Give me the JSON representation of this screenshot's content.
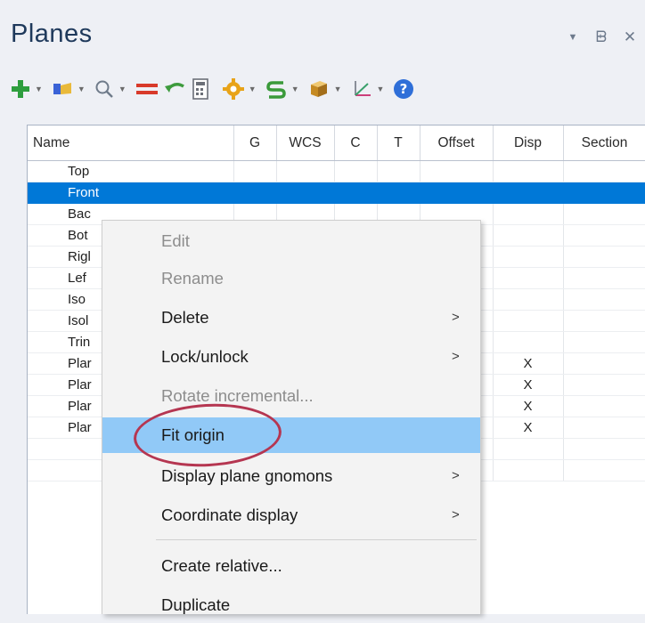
{
  "panel": {
    "title": "Planes",
    "controls": {
      "dropdown_icon": "▼",
      "pin_icon": "ᗸ",
      "close_icon": "✕"
    }
  },
  "toolbar": {
    "items": [
      {
        "icon": "add-icon",
        "has_dropdown": true,
        "color": "#2e9e3e"
      },
      {
        "icon": "planes-folder-icon",
        "has_dropdown": true,
        "color": "#3a62d6"
      },
      {
        "icon": "search-icon",
        "has_dropdown": true,
        "color": "#6f7b8a"
      },
      {
        "icon": "equal-icon",
        "has_dropdown": false,
        "color": "#d83a2a"
      },
      {
        "icon": "undo-arrow-icon",
        "has_dropdown": false,
        "color": "#3d9b3d"
      },
      {
        "icon": "calculator-icon",
        "has_dropdown": false,
        "color": "#6b6f78"
      },
      {
        "icon": "gear-icon",
        "has_dropdown": true,
        "color": "#e8a318"
      },
      {
        "icon": "rotate-s-icon",
        "has_dropdown": true,
        "color": "#3a9a3a"
      },
      {
        "icon": "box-icon",
        "has_dropdown": true,
        "color": "#d7a636"
      },
      {
        "icon": "axis-gnomon-icon",
        "has_dropdown": true,
        "color": "#cc3f7a"
      },
      {
        "icon": "help-icon",
        "has_dropdown": false,
        "color": "#2f6fd8"
      }
    ]
  },
  "grid": {
    "columns": [
      "Name",
      "G",
      "WCS",
      "C",
      "T",
      "Offset",
      "Disp",
      "Section"
    ],
    "rows": [
      {
        "name": "Top",
        "disp": ""
      },
      {
        "name": "Front",
        "disp": "",
        "selected": true
      },
      {
        "name": "Bac",
        "disp": ""
      },
      {
        "name": "Bot",
        "disp": ""
      },
      {
        "name": "Rigl",
        "disp": ""
      },
      {
        "name": "Lef",
        "disp": ""
      },
      {
        "name": "Iso",
        "disp": ""
      },
      {
        "name": "Isol",
        "disp": ""
      },
      {
        "name": "Trin",
        "disp": ""
      },
      {
        "name": "Plar",
        "disp": "X"
      },
      {
        "name": "Plar",
        "disp": "X"
      },
      {
        "name": "Plar",
        "disp": "X"
      },
      {
        "name": "Plar",
        "disp": "X"
      },
      {
        "name": "",
        "disp": ""
      },
      {
        "name": "",
        "disp": ""
      }
    ]
  },
  "context_menu": {
    "items": [
      {
        "label": "Edit",
        "enabled": false,
        "submenu": false
      },
      {
        "label": "Rename",
        "enabled": false,
        "submenu": false
      },
      {
        "label": "Delete",
        "enabled": true,
        "submenu": true
      },
      {
        "label": "Lock/unlock",
        "enabled": true,
        "submenu": true
      },
      {
        "label": "Rotate incremental...",
        "enabled": false,
        "submenu": false
      },
      {
        "label": "Fit origin",
        "enabled": true,
        "submenu": false,
        "hovered": true
      },
      {
        "label": "Display plane gnomons",
        "enabled": true,
        "submenu": true
      },
      {
        "label": "Coordinate display",
        "enabled": true,
        "submenu": true
      },
      {
        "label": "Create relative...",
        "enabled": true,
        "submenu": false
      },
      {
        "label": "Duplicate",
        "enabled": true,
        "submenu": false
      }
    ],
    "submenu_arrow": ">",
    "highlight_color": "#b53651"
  }
}
